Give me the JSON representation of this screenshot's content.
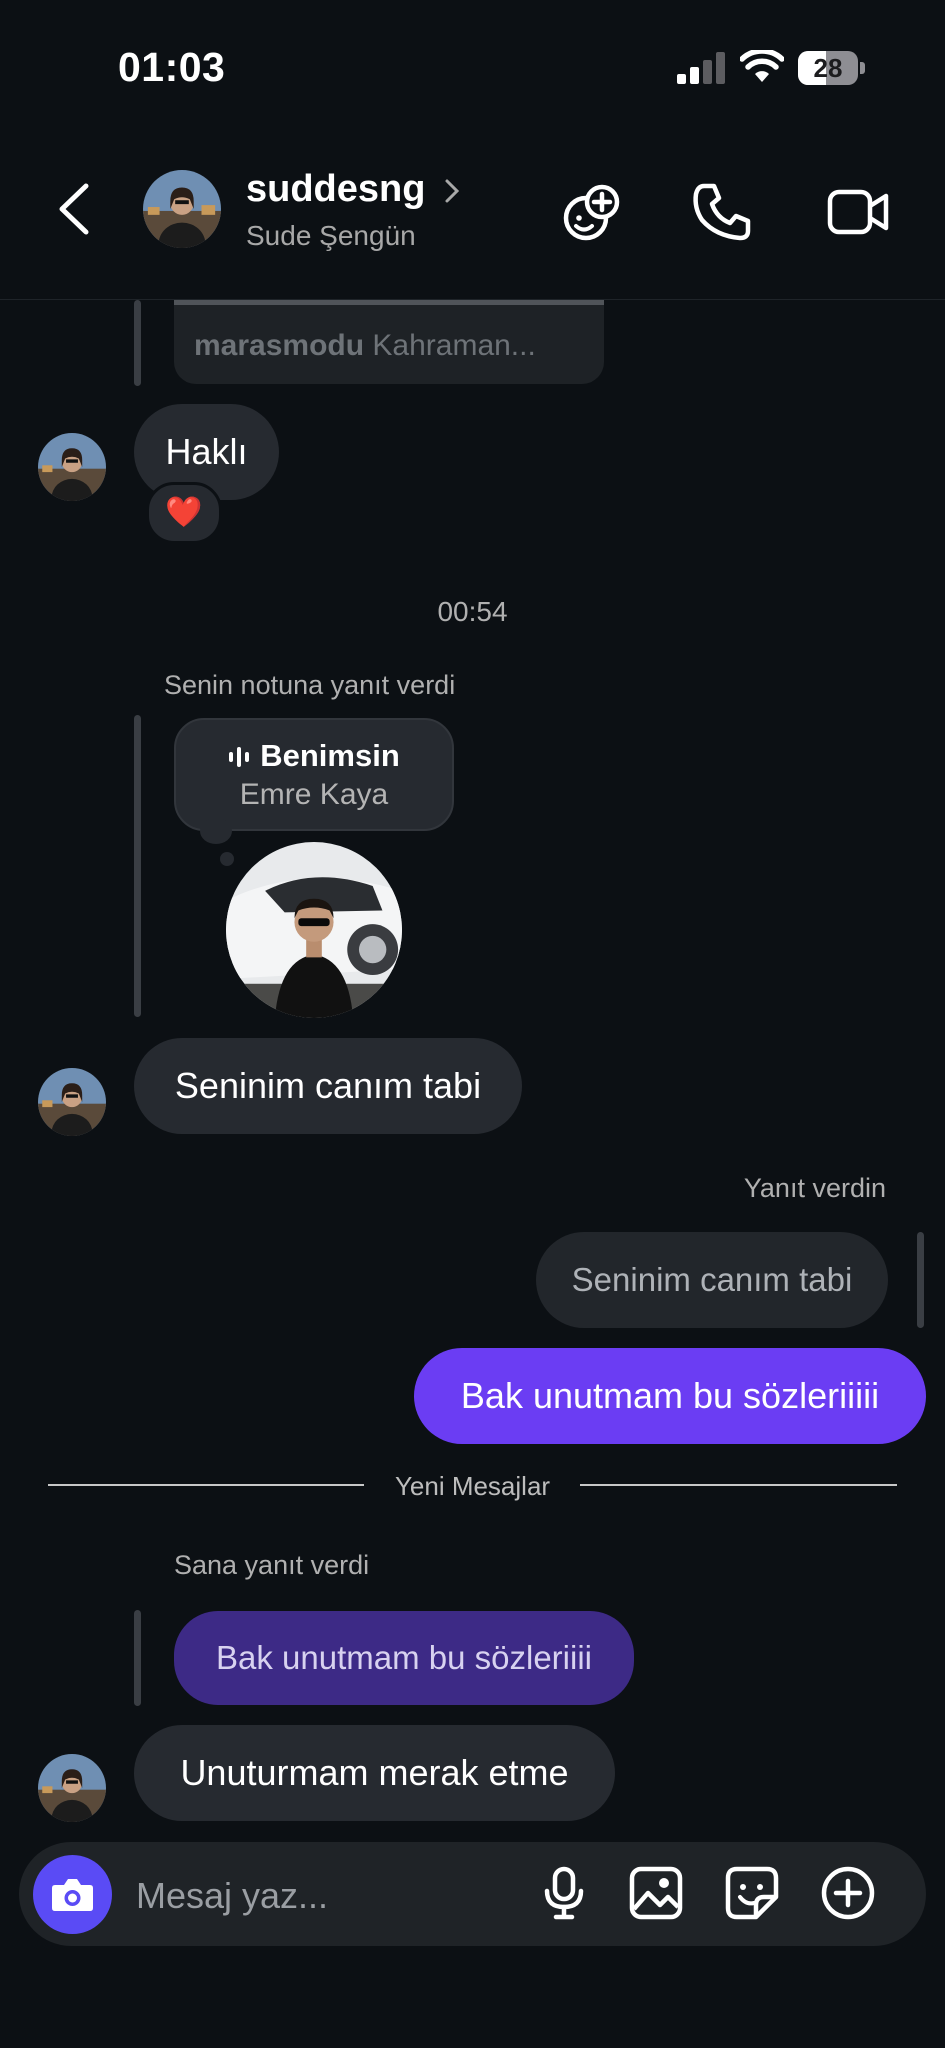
{
  "status_bar": {
    "time": "01:03",
    "battery": "28"
  },
  "header": {
    "username": "suddesng",
    "display_name": "Sude Şengün"
  },
  "messages": {
    "quoted_preview": {
      "bold": "marasmodu",
      "rest": " Kahraman..."
    },
    "m1": {
      "text": "Haklı",
      "reaction": "❤️"
    },
    "timestamp": "00:54",
    "note_reply_label": "Senin notuna yanıt verdi",
    "note": {
      "title": "Benimsin",
      "subtitle": "Emre Kaya"
    },
    "m2": {
      "text": "Seninim canım tabi"
    },
    "my_reply_label": "Yanıt verdin",
    "my_quoted": "Seninim canım tabi",
    "m3": {
      "text": "Bak unutmam bu sözleriiiii"
    },
    "new_messages_label": "Yeni Mesajlar",
    "their_reply_label": "Sana yanıt verdi",
    "their_quoted": "Bak unutmam bu sözleriiii",
    "m4": {
      "text": "Unuturmam merak etme"
    }
  },
  "composer": {
    "placeholder": "Mesaj yaz..."
  },
  "colors": {
    "background": "#0c1014",
    "incoming_bubble": "#262a30",
    "outgoing_bubble": "#6b3df3",
    "camera_button": "#5a4bf5"
  }
}
